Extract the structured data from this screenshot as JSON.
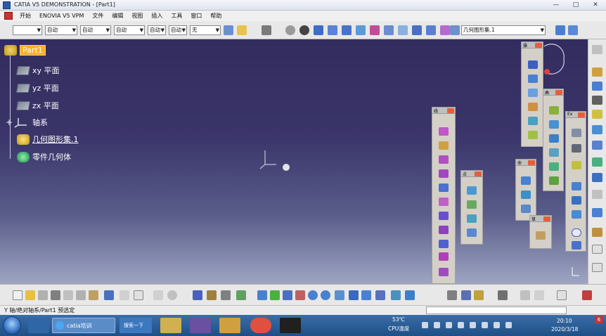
{
  "window": {
    "title": "CATIA V5 DEMONSTRATION - [Part1]",
    "controls": [
      "—",
      "□",
      "✕"
    ]
  },
  "menu": {
    "items": [
      "开始",
      "ENOVIA V5 VPM",
      "文件",
      "编辑",
      "视图",
      "插入",
      "工具",
      "窗口",
      "帮助"
    ]
  },
  "toolbar": {
    "line_style_value": "",
    "combo_values": [
      "自动",
      "自动",
      "自动",
      "自动",
      "自动",
      "无"
    ],
    "geometry_set_value": "几何图形集.1"
  },
  "tree": {
    "root": "Part1",
    "nodes": [
      "xy 平面",
      "yz 平面",
      "zx 平面",
      "轴系",
      "几何图形集.1",
      "零件几何体"
    ]
  },
  "floating_toolbars": {
    "titles": [
      "线",
      "点",
      "操",
      "曲",
      "命",
      "草",
      "Ex"
    ]
  },
  "statusbar": {
    "message": "Y 轴/绝对轴系/Part1 预选定"
  },
  "taskbar": {
    "search_label": "搜索一下",
    "task_catia": "catia培训",
    "weather": "53℃",
    "cpu": "CPU温度",
    "time": "20:10",
    "date": "2020/3/18",
    "notify_count": "6"
  },
  "colors": {
    "workspace_top": "#332c5e",
    "workspace_bottom": "#9ea5c3",
    "tree_highlight": "#ffae2d",
    "taskbar": "#1e4f86"
  }
}
